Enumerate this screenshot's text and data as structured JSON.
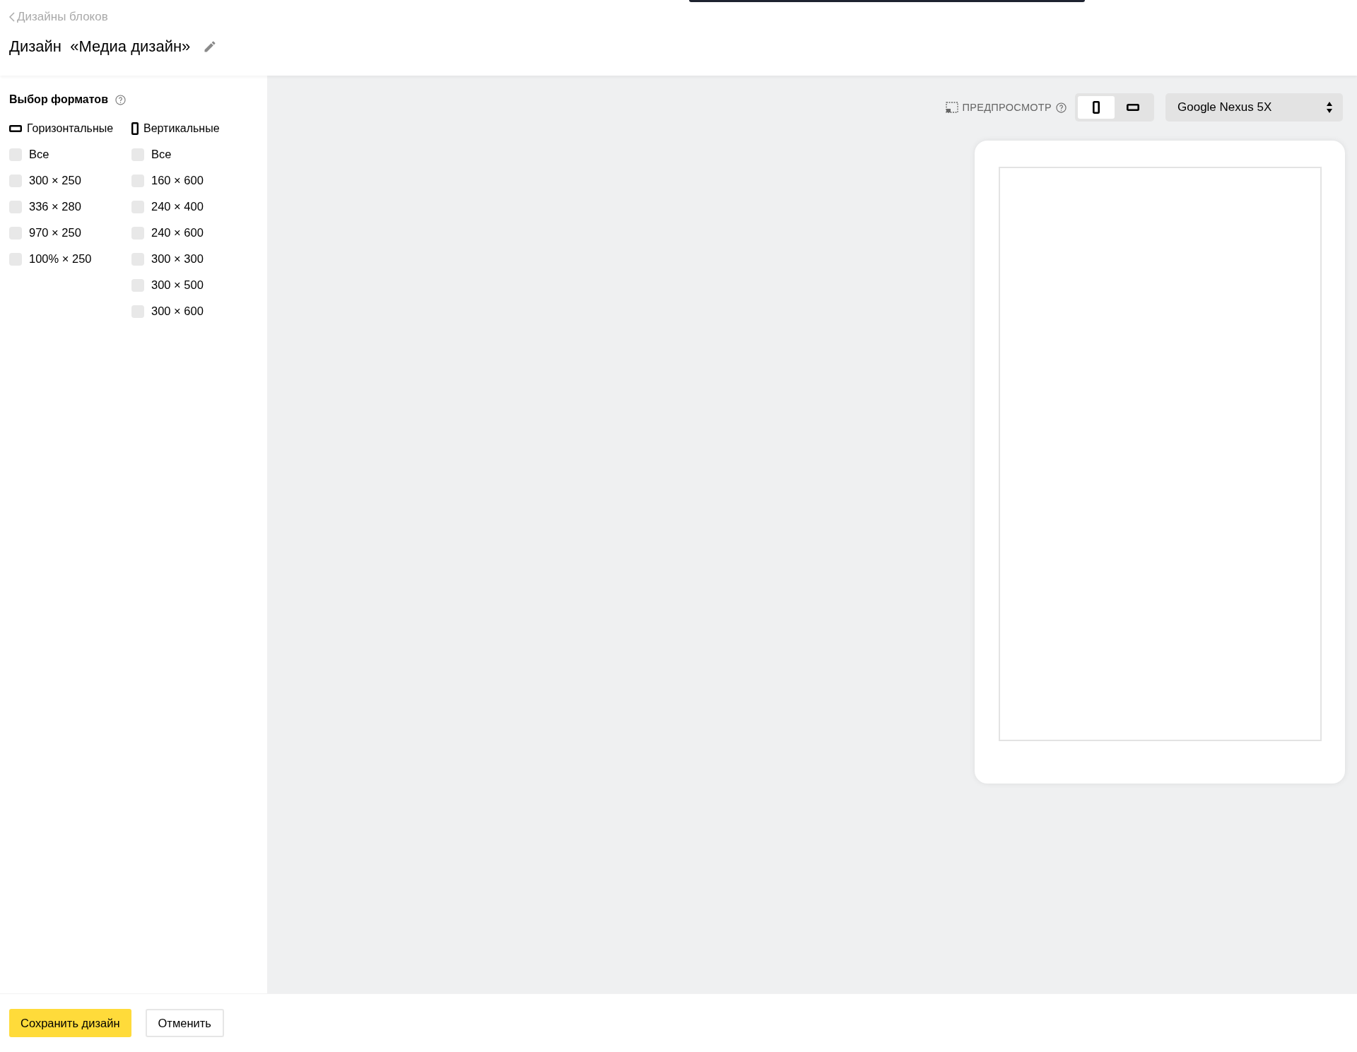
{
  "header": {
    "back_link": "Дизайны блоков",
    "title": "Дизайн  «Медиа дизайн»"
  },
  "formats": {
    "title": "Выбор форматов",
    "groups": [
      {
        "kind": "horizontal",
        "label": "Горизонтальные",
        "options": [
          {
            "label": "Все",
            "checked": false
          },
          {
            "label": "300 × 250",
            "checked": false
          },
          {
            "label": "336 × 280",
            "checked": false
          },
          {
            "label": "970 × 250",
            "checked": false
          },
          {
            "label": "100% × 250",
            "checked": false
          }
        ]
      },
      {
        "kind": "vertical",
        "label": "Вертикальные",
        "options": [
          {
            "label": "Все",
            "checked": false
          },
          {
            "label": "160 × 600",
            "checked": false
          },
          {
            "label": "240 × 400",
            "checked": false
          },
          {
            "label": "240 × 600",
            "checked": false
          },
          {
            "label": "300 × 300",
            "checked": false
          },
          {
            "label": "300 × 500",
            "checked": false
          },
          {
            "label": "300 × 600",
            "checked": false
          }
        ]
      }
    ]
  },
  "preview": {
    "label": "ПРЕДПРОСМОТР",
    "orientations": [
      {
        "kind": "portrait",
        "selected": true
      },
      {
        "kind": "landscape",
        "selected": false
      }
    ],
    "device": "Google Nexus 5X"
  },
  "footer": {
    "buttons": [
      {
        "kind": "primary",
        "label": "Сохранить дизайн"
      },
      {
        "kind": "secondary",
        "label": "Отменить"
      }
    ]
  }
}
